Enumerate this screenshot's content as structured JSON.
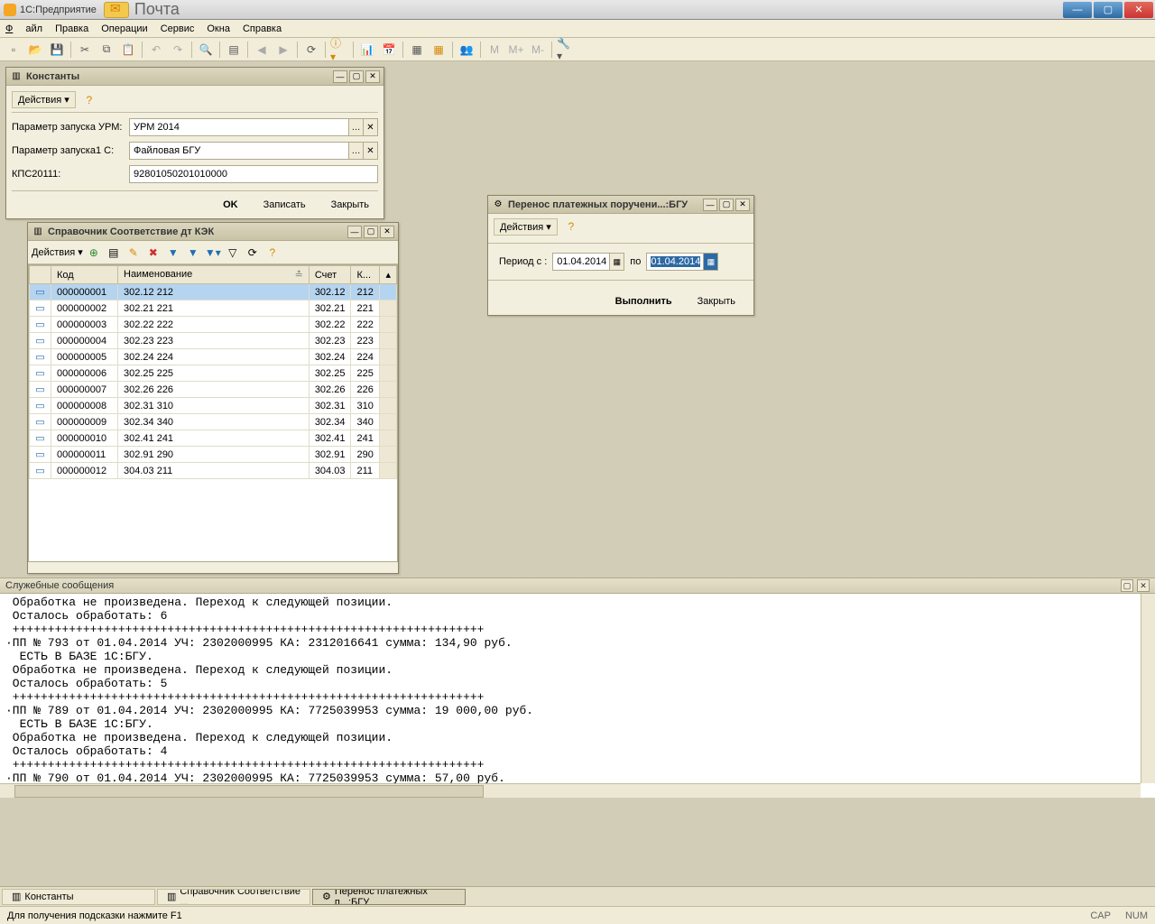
{
  "titlebar": {
    "app": "1С:Предприятие",
    "mail": "Почта"
  },
  "menu": [
    "Файл",
    "Правка",
    "Операции",
    "Сервис",
    "Окна",
    "Справка"
  ],
  "constants": {
    "title": "Константы",
    "actions": "Действия",
    "rows": [
      {
        "label": "Параметр запуска УРМ:",
        "value": "УРМ 2014"
      },
      {
        "label": "Параметр запуска1 С:",
        "value": "Файловая БГУ"
      },
      {
        "label": "КПС20111:",
        "value": "92801050201010000"
      }
    ],
    "ok": "OK",
    "save": "Записать",
    "close": "Закрыть"
  },
  "reference": {
    "title": "Справочник Соответствие дт КЭК",
    "actions": "Действия",
    "cols": [
      "",
      "Код",
      "Наименование",
      "Счет",
      "К..."
    ],
    "rows": [
      {
        "code": "000000001",
        "name": "302.12 212",
        "acct": "302.12",
        "k": "212"
      },
      {
        "code": "000000002",
        "name": "302.21 221",
        "acct": "302.21",
        "k": "221"
      },
      {
        "code": "000000003",
        "name": "302.22 222",
        "acct": "302.22",
        "k": "222"
      },
      {
        "code": "000000004",
        "name": "302.23 223",
        "acct": "302.23",
        "k": "223"
      },
      {
        "code": "000000005",
        "name": "302.24 224",
        "acct": "302.24",
        "k": "224"
      },
      {
        "code": "000000006",
        "name": "302.25 225",
        "acct": "302.25",
        "k": "225"
      },
      {
        "code": "000000007",
        "name": "302.26 226",
        "acct": "302.26",
        "k": "226"
      },
      {
        "code": "000000008",
        "name": "302.31 310",
        "acct": "302.31",
        "k": "310"
      },
      {
        "code": "000000009",
        "name": "302.34 340",
        "acct": "302.34",
        "k": "340"
      },
      {
        "code": "000000010",
        "name": "302.41 241",
        "acct": "302.41",
        "k": "241"
      },
      {
        "code": "000000011",
        "name": "302.91 290",
        "acct": "302.91",
        "k": "290"
      },
      {
        "code": "000000012",
        "name": "304.03 211",
        "acct": "304.03",
        "k": "211"
      }
    ]
  },
  "transfer": {
    "title": "Перенос платежных поручени...:БГУ",
    "actions": "Действия",
    "period_from_label": "Период с :",
    "from": "01.04.2014",
    "to_label": "по",
    "to": "01.04.2014",
    "execute": "Выполнить",
    "close": "Закрыть"
  },
  "messages": {
    "title": "Служебные сообщения",
    "lines": [
      " Обработка не произведена. Переход к следующей позиции.",
      " Осталось обработать: 6",
      " +++++++++++++++++++++++++++++++++++++++++++++++++++++++++++++++++++",
      "·ПП № 793 от 01.04.2014 УЧ: 2302000995 КА: 2312016641 сумма: 134,90 руб.",
      "  ЕСТЬ В БАЗЕ 1С:БГУ.",
      " Обработка не произведена. Переход к следующей позиции.",
      " Осталось обработать: 5",
      " +++++++++++++++++++++++++++++++++++++++++++++++++++++++++++++++++++",
      "·ПП № 789 от 01.04.2014 УЧ: 2302000995 КА: 7725039953 сумма: 19 000,00 руб.",
      "  ЕСТЬ В БАЗЕ 1С:БГУ.",
      " Обработка не произведена. Переход к следующей позиции.",
      " Осталось обработать: 4",
      " +++++++++++++++++++++++++++++++++++++++++++++++++++++++++++++++++++",
      "·ПП № 790 от 01.04.2014 УЧ: 2302000995 КА: 7725039953 сумма: 57,00 руб."
    ]
  },
  "taskbar": {
    "items": [
      "Константы",
      "Справочник Соответствие ...",
      "Перенос платежных п...:БГУ"
    ]
  },
  "status": {
    "hint": "Для получения подсказки нажмите F1",
    "cap": "CAP",
    "num": "NUM"
  }
}
